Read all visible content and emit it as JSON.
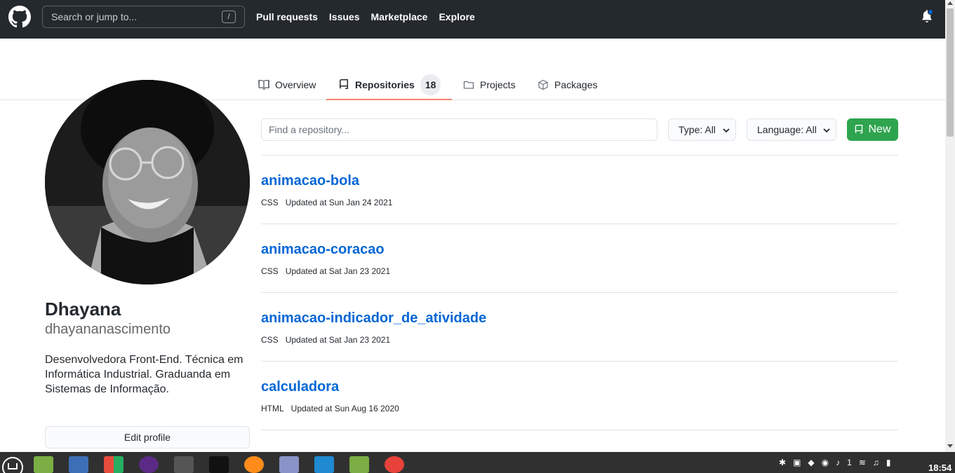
{
  "header": {
    "search_placeholder": "Search or jump to...",
    "search_shortcut": "/",
    "nav": [
      "Pull requests",
      "Issues",
      "Marketplace",
      "Explore"
    ]
  },
  "tabs": [
    {
      "label": "Overview"
    },
    {
      "label": "Repositories",
      "count": "18"
    },
    {
      "label": "Projects"
    },
    {
      "label": "Packages"
    }
  ],
  "profile": {
    "name": "Dhayana",
    "login": "dhayananascimento",
    "bio": "Desenvolvedora Front-End. Técnica em Informática Industrial. Graduanda em Sistemas de Informação.",
    "edit_label": "Edit profile"
  },
  "filters": {
    "find_placeholder": "Find a repository...",
    "type_label": "Type: All",
    "language_label": "Language: All",
    "new_label": "New"
  },
  "repos": [
    {
      "name": "animacao-bola",
      "language": "CSS",
      "updated": "Updated at Sun Jan 24 2021"
    },
    {
      "name": "animacao-coracao",
      "language": "CSS",
      "updated": "Updated at Sat Jan 23 2021"
    },
    {
      "name": "animacao-indicador_de_atividade",
      "language": "CSS",
      "updated": "Updated at Sat Jan 23 2021"
    },
    {
      "name": "calculadora",
      "language": "HTML",
      "updated": "Updated at Sun Aug 16 2020"
    }
  ],
  "taskbar": {
    "notification_count": "1",
    "clock": "18:54"
  },
  "colors": {
    "header_bg": "#24292e",
    "link": "#0366d6",
    "accent_tab": "#f9826c",
    "new_button": "#2ea44f"
  }
}
